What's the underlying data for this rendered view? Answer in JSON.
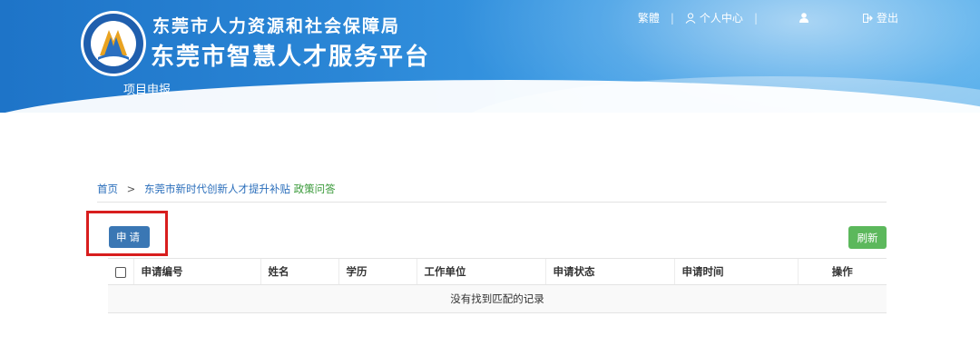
{
  "header": {
    "org_title": "东莞市人力资源和社会保障局",
    "platform_title": "东莞市智慧人才服务平台",
    "subnav": "项目申报",
    "links": {
      "traditional": "繁體",
      "user_center": "个人中心",
      "logout": "登出"
    }
  },
  "breadcrumb": {
    "home": "首页",
    "arrow": ">",
    "project": "东莞市新时代创新人才提升补贴",
    "current": "政策问答"
  },
  "toolbar": {
    "apply_label": "申请",
    "refresh_label": "刷新"
  },
  "table": {
    "columns": [
      "申请编号",
      "姓名",
      "学历",
      "工作单位",
      "申请状态",
      "申请时间",
      "操作"
    ],
    "empty_message": "没有找到匹配的记录"
  },
  "colors": {
    "header_blue": "#2a86d6",
    "apply_button": "#3a77b4",
    "refresh_button": "#5cb85c",
    "highlight_border": "#d81e1e"
  }
}
